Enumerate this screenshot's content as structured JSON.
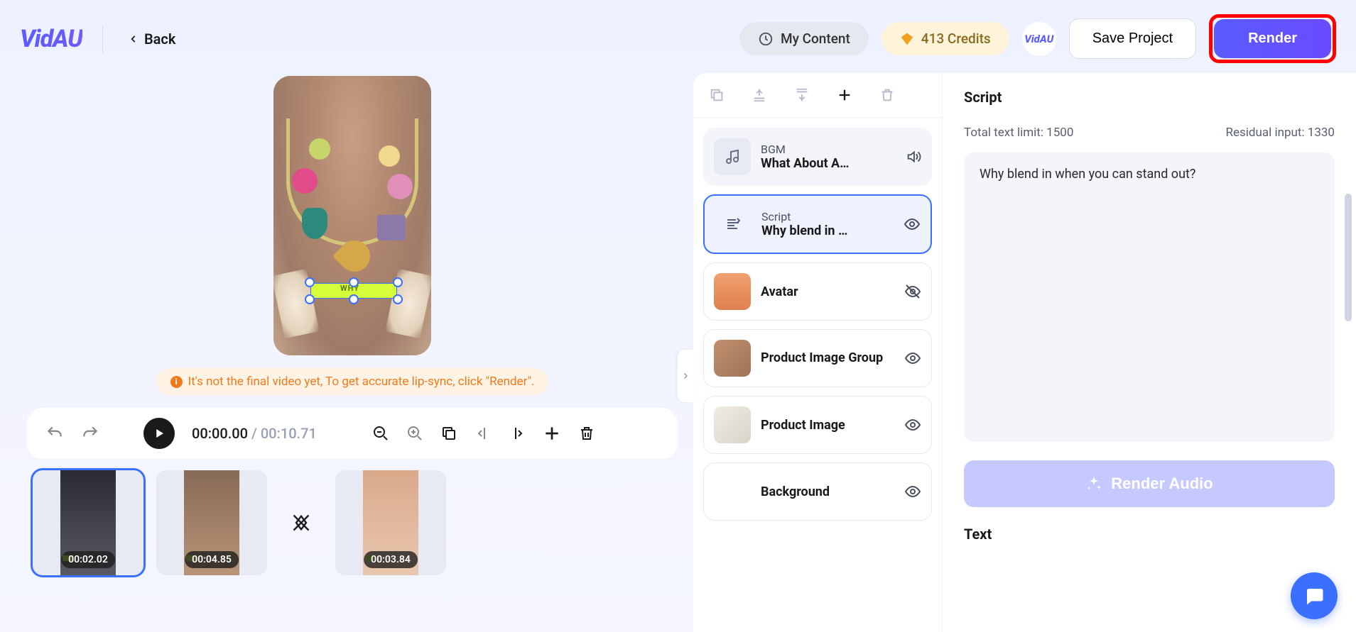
{
  "header": {
    "logo": "VidAU",
    "back": "Back",
    "my_content": "My Content",
    "credits": "413 Credits",
    "brand_badge": "VidAU",
    "save_project": "Save Project",
    "render": "Render"
  },
  "canvas": {
    "selection_text": "WHY",
    "hint": "It's not the final video yet, To get accurate lip-sync, click \"Render\"."
  },
  "timeline": {
    "current": "00:00.00",
    "total": "00:10.71"
  },
  "clips": [
    {
      "duration": "00:02.02",
      "active": true
    },
    {
      "duration": "00:04.85",
      "active": false
    },
    {
      "transition": true
    },
    {
      "duration": "00:03.84",
      "active": false
    }
  ],
  "layers": {
    "bgm": {
      "label": "BGM",
      "title": "What About A…"
    },
    "items": [
      {
        "id": "script",
        "label": "Script",
        "title": "Why blend in …",
        "active": true,
        "hidden": false
      },
      {
        "id": "avatar",
        "title": "Avatar",
        "hidden": true
      },
      {
        "id": "pig",
        "title": "Product Image Group",
        "hidden": false
      },
      {
        "id": "pi",
        "title": "Product Image",
        "hidden": false
      },
      {
        "id": "bg",
        "title": "Background",
        "hidden": false
      }
    ]
  },
  "script_panel": {
    "title": "Script",
    "total_limit_label": "Total text limit: 1500",
    "residual_label": "Residual input: 1330",
    "content": "Why blend in when you can stand out?",
    "render_audio": "Render Audio",
    "text_section": "Text"
  }
}
